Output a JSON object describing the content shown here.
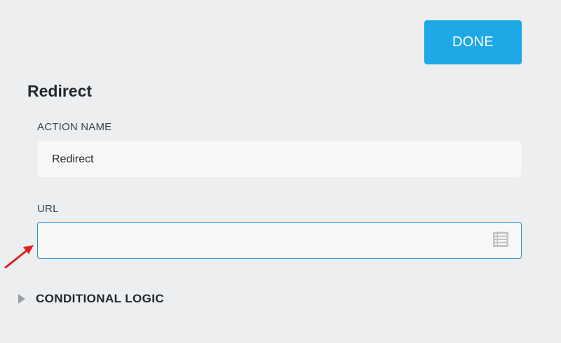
{
  "header": {
    "done_label": "DONE"
  },
  "section": {
    "title": "Redirect"
  },
  "fields": {
    "action_name": {
      "label": "ACTION NAME",
      "value": "Redirect"
    },
    "url": {
      "label": "URL",
      "value": ""
    }
  },
  "conditional_logic": {
    "label": "CONDITIONAL LOGIC",
    "expanded": false
  },
  "icons": {
    "merge_tag": "merge-tag-icon",
    "toggle": "triangle-right-icon",
    "annotation": "red-arrow-icon"
  },
  "colors": {
    "accent": "#1fa8e6",
    "focus_border": "#2b8ccf",
    "annotation": "#e02020"
  }
}
